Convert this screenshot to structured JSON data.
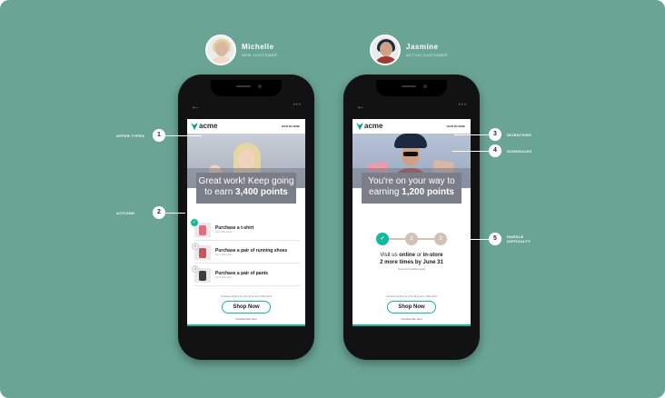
{
  "personas": [
    {
      "name": "Michelle",
      "role": "NEW CUSTOMER"
    },
    {
      "name": "Jasmine",
      "role": "ACTIVE CUSTOMER"
    }
  ],
  "brand": {
    "logo_text": "acme",
    "accent": "#14b8a0",
    "background": "#6aa593"
  },
  "phone1": {
    "header_link": "SIGN IN HERE",
    "banner_line1": "Great work! Keep going",
    "banner_prefix": "to earn",
    "banner_points": "3,400 points",
    "tasks": [
      {
        "title": "Purchase a t-shirt",
        "sub": "Get 1,000 points",
        "status": "done"
      },
      {
        "title": "Purchase a pair of running shoes",
        "sub": "Get 1,200 points",
        "status": "2"
      },
      {
        "title": "Purchase a pair of pants",
        "sub": "Get 1,200 points",
        "status": "3"
      }
    ],
    "fineprint": "Complete all three by June 30 to earn 3,400 points",
    "shop_button": "Shop Now",
    "unsubscribe": "Unsubscribe here"
  },
  "phone2": {
    "header_link": "SIGN IN HERE",
    "banner_line1": "You're on your way to",
    "banner_prefix": "earning",
    "banner_points": "1,200 points",
    "steps": [
      "✓",
      "2",
      "3"
    ],
    "visit_prefix": "Visit us",
    "visit_online": "online",
    "visit_or": "or",
    "visit_instore": "in-store",
    "visit_line2": "2 more times by June 31",
    "visit_small": "Terms and conditions apply",
    "fineprint": "Complete all three by June 30 to earn 1,200 points",
    "shop_button": "Shop Now",
    "unsubscribe": "Unsubscribe here"
  },
  "callouts": [
    {
      "num": "1",
      "label": "OFFER TYPES"
    },
    {
      "num": "2",
      "label": "ACTIONS"
    },
    {
      "num": "3",
      "label": "INCENTIVES"
    },
    {
      "num": "4",
      "label": "SCHEDULES"
    },
    {
      "num": "5",
      "label_line1": "HURDLE",
      "label_line2": "DIFFICULTY"
    }
  ],
  "icons": {
    "back": "back-arrow-icon",
    "more": "more-dots-icon",
    "check": "check-icon",
    "logo": "leaf-logo-icon"
  }
}
